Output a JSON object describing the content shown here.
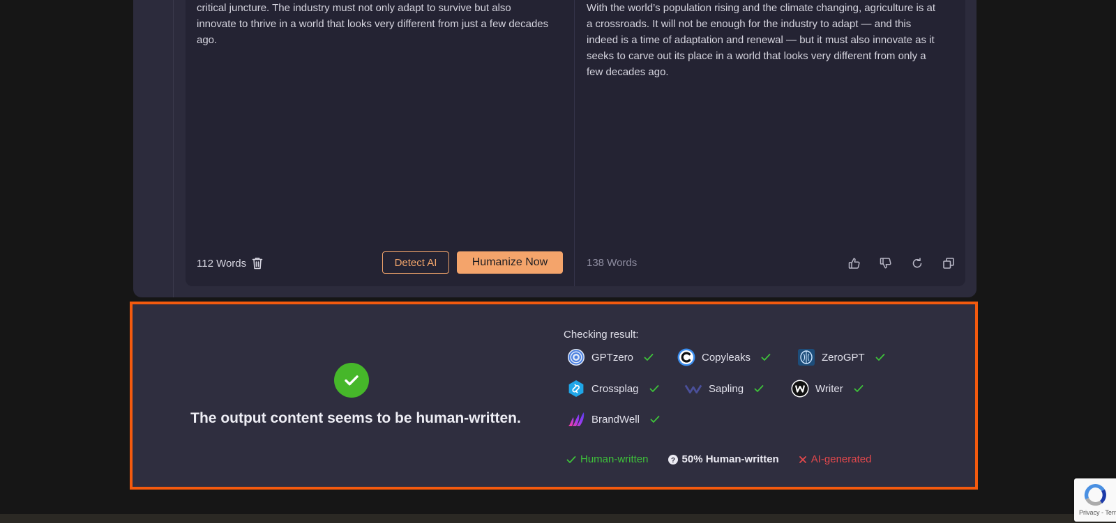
{
  "input_pane": {
    "text": [
      "population grows and the climate continues to shift, agriculture stands at a critical juncture. The industry must not only adapt to survive but also innovate to thrive in a world that looks very different from just a few decades ago."
    ],
    "word_count": "112 Words",
    "detect_label": "Detect AI",
    "humanize_label": "Humanize Now"
  },
  "output_pane": {
    "text": [
      "damage economies, and threaten the incomes of millions. At a crossroad With the world’s population rising and the  climate changing, agriculture is at a crossroads. It will not be enough for the industry to  adapt — and this indeed is a time of adaptation and renewal — but it must also innovate as it seeks to carve out its place in a world that looks very different from only a few decades ago."
    ],
    "word_count": "138 Words",
    "actions": [
      "thumbs-up-icon",
      "thumbs-down-icon",
      "regenerate-icon",
      "copy-icon"
    ]
  },
  "result": {
    "verdict": "The output content seems to be human-written.",
    "checking_title": "Checking result:",
    "detectors": [
      {
        "name": "GPTzero",
        "icon": "gptzero-logo"
      },
      {
        "name": "Copyleaks",
        "icon": "copyleaks-logo"
      },
      {
        "name": "ZeroGPT",
        "icon": "zerogpt-logo"
      },
      {
        "name": "Crossplag",
        "icon": "crossplag-logo"
      },
      {
        "name": "Sapling",
        "icon": "sapling-logo"
      },
      {
        "name": "Writer",
        "icon": "writer-logo"
      },
      {
        "name": "BrandWell",
        "icon": "brandwell-logo"
      }
    ],
    "legend": {
      "human": "Human-written",
      "half": "50% Human-written",
      "ai": "AI-generated"
    }
  },
  "recaptcha": {
    "text": "Privacy - Terms"
  },
  "colors": {
    "accent": "#f4a46b",
    "highlight_border": "#f45a0e",
    "success": "#46b72a",
    "error": "#e4484c"
  }
}
